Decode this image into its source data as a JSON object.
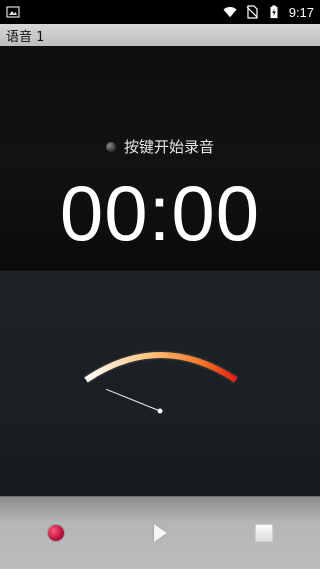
{
  "status_bar": {
    "time": "9:17",
    "icons": [
      "image-icon",
      "wifi-icon",
      "no-sim-icon",
      "battery-charging-icon"
    ]
  },
  "app": {
    "title": "语音 1"
  },
  "display": {
    "status_text": "按键开始录音",
    "timer": "00:00"
  },
  "meter": {
    "level": 0,
    "arc_colors": [
      "#ffffff",
      "#ffc07a",
      "#f37021",
      "#e51d15"
    ]
  },
  "controls": {
    "buttons": [
      "record-button",
      "play-button",
      "stop-button"
    ],
    "record_color": "#c0153e"
  }
}
